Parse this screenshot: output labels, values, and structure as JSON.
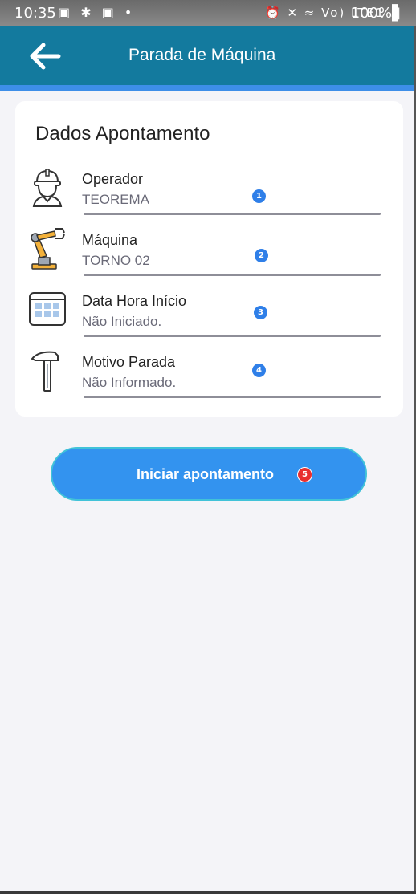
{
  "status_bar": {
    "time": "10:35",
    "left_icons": "▣ ✱ ▣ •",
    "right_icons": "⏰ ✕ ≈ Vo) LTE1 .∣",
    "battery": "100%▌"
  },
  "app_bar": {
    "title": "Parada de Máquina",
    "back_icon": "arrow-left-icon",
    "color": "#137a9e",
    "stripe_color": "#3d8ee8"
  },
  "card": {
    "title": "Dados Apontamento",
    "fields": [
      {
        "label": "Operador",
        "value": "TEOREMA",
        "icon": "worker-helmet-icon",
        "badge": "1"
      },
      {
        "label": "Máquina",
        "value": "TORNO 02",
        "icon": "robot-arm-icon",
        "badge": "2"
      },
      {
        "label": "Data Hora Início",
        "value": "Não Iniciado.",
        "icon": "calendar-icon",
        "badge": "3"
      },
      {
        "label": "Motivo Parada",
        "value": "Não Informado.",
        "icon": "hammer-icon",
        "badge": "4"
      }
    ]
  },
  "start_button": {
    "label": "Iniciar apontamento",
    "badge": "5",
    "color": "#3393ef"
  }
}
